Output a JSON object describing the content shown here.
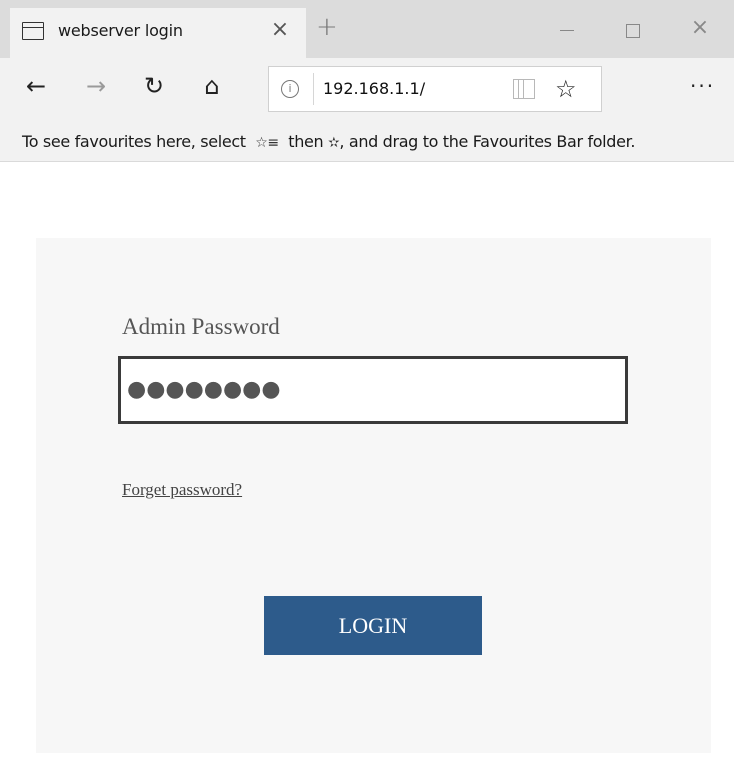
{
  "tab": {
    "title": "webserver login",
    "close_icon": "×",
    "new_tab_icon": "+"
  },
  "window": {
    "minimize_icon": "minimize-icon",
    "maximize_icon": "maximize-icon",
    "close_icon": "×"
  },
  "nav": {
    "back_icon": "←",
    "forward_icon": "→",
    "refresh_icon": "↻",
    "home_icon": "⌂",
    "info_icon": "i",
    "url": "192.168.1.1/",
    "favorite_icon": "☆",
    "more_icon": "···"
  },
  "favourites_bar": {
    "text_before": "To see favourites here, select",
    "hub_glyph": "☆≡",
    "text_middle": "then",
    "star_glyph": "✫",
    "text_after": ", and drag to the Favourites Bar folder."
  },
  "login": {
    "label": "Admin Password",
    "password_mask": "●●●●●●●●",
    "forgot_link": "Forget password?",
    "button_label": "LOGIN",
    "button_color": "#2d5b8b",
    "card_background": "#f7f7f7"
  }
}
